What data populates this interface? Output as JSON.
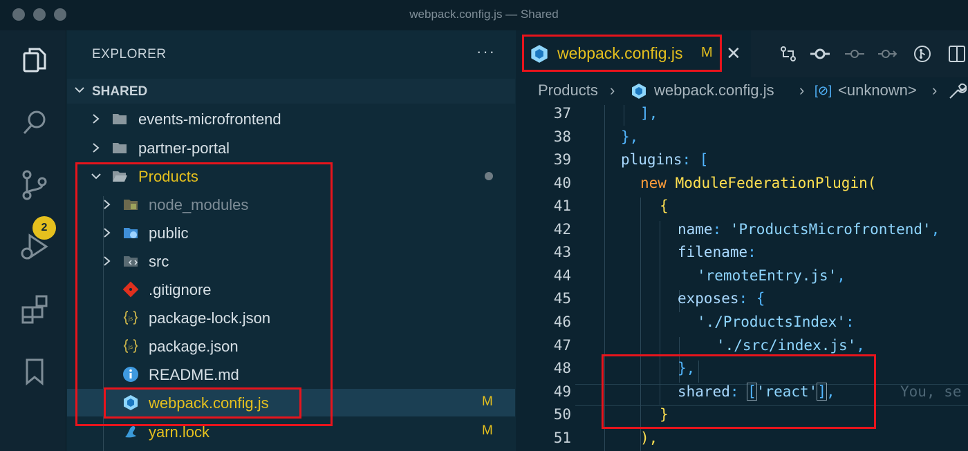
{
  "window": {
    "title": "webpack.config.js — Shared"
  },
  "activity_bar": {
    "source_control_badge": "2",
    "more": "..."
  },
  "sidebar": {
    "title": "EXPLORER",
    "more": "···",
    "section": "SHARED",
    "items": [
      {
        "label": "events-microfrontend",
        "status": ""
      },
      {
        "label": "partner-portal",
        "status": ""
      },
      {
        "label": "Products",
        "status": ""
      },
      {
        "label": "node_modules",
        "status": ""
      },
      {
        "label": "public",
        "status": ""
      },
      {
        "label": "src",
        "status": ""
      },
      {
        "label": ".gitignore",
        "status": ""
      },
      {
        "label": "package-lock.json",
        "status": ""
      },
      {
        "label": "package.json",
        "status": ""
      },
      {
        "label": "README.md",
        "status": ""
      },
      {
        "label": "webpack.config.js",
        "status": "M"
      },
      {
        "label": "yarn.lock",
        "status": "M"
      }
    ]
  },
  "editor": {
    "tab": {
      "label": "webpack.config.js",
      "status": "M"
    },
    "breadcrumb": [
      "Products",
      "webpack.config.js",
      "<unknown>"
    ],
    "line_numbers": [
      "37",
      "38",
      "39",
      "40",
      "41",
      "42",
      "43",
      "44",
      "45",
      "46",
      "47",
      "48",
      "49",
      "50",
      "51"
    ],
    "code": {
      "l37": "],",
      "l38": "},",
      "l39_a": "plugins",
      "l39_b": ": [",
      "l40_a": "new ",
      "l40_b": "ModuleFederationPlugin",
      "l40_c": "(",
      "l41": "{",
      "l42_a": "name",
      "l42_b": ": ",
      "l42_c": "'ProductsMicrofrontend'",
      "l42_d": ",",
      "l43_a": "filename",
      "l43_b": ":",
      "l44_a": "'remoteEntry.js'",
      "l44_b": ",",
      "l45_a": "exposes",
      "l45_b": ": {",
      "l46_a": "'./ProductsIndex'",
      "l46_b": ":",
      "l47_a": "'./src/index.js'",
      "l47_b": ",",
      "l48": "},",
      "l49_a": "shared",
      "l49_b": ": ",
      "l49_c": "[",
      "l49_d": "'react'",
      "l49_e": "]",
      "l49_f": ",",
      "l49_ghost": "You, se",
      "l50": "}",
      "l51": "),"
    }
  },
  "colors": {
    "accent_yellow": "#e5c01e",
    "highlight_red": "#e8141c",
    "background": "#0f2a38"
  }
}
